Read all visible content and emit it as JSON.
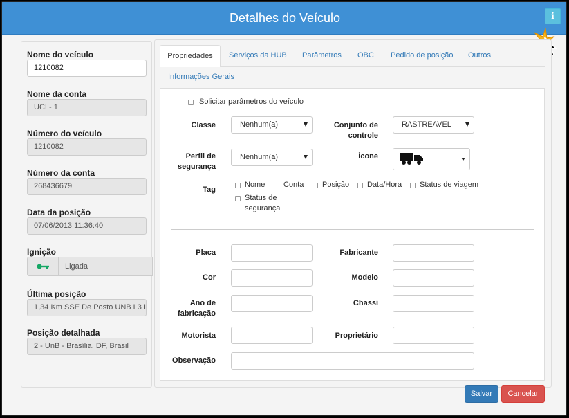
{
  "window": {
    "title": "Detalhes do Veículo",
    "info_icon": "i"
  },
  "left": {
    "vehicle_name": {
      "label": "Nome do veículo",
      "value": "1210082"
    },
    "account_name": {
      "label": "Nome da conta",
      "value": "UCI - 1"
    },
    "vehicle_number": {
      "label": "Número do veículo",
      "value": "1210082"
    },
    "account_number": {
      "label": "Número da conta",
      "value": "268436679"
    },
    "position_date": {
      "label": "Data da posição",
      "value": "07/06/2013 11:36:40"
    },
    "ignition": {
      "label": "Ignição",
      "value": "Ligada",
      "icon": "key-icon"
    },
    "last_position": {
      "label": "Última posição",
      "value": "1,34 Km SSE De Posto UNB L3 I"
    },
    "detailed_position": {
      "label": "Posição detalhada",
      "value": "2 - UnB - Brasília, DF, Brasil"
    }
  },
  "tabs": [
    "Propriedades",
    "Serviços da HUB",
    "Parâmetros",
    "OBC",
    "Pedido de posição",
    "Outros",
    "Informações Gerais"
  ],
  "props": {
    "request_params": "Solicitar parâmetros do veículo",
    "class_label": "Classe",
    "class_value": "Nenhum(a)",
    "control_set_label_1": "Conjunto de",
    "control_set_label_2": "controle",
    "control_set_value": "RASTREAVEL",
    "security_label_1": "Perfil de",
    "security_label_2": "segurança",
    "security_value": "Nenhum(a)",
    "icon_label": "Ícone",
    "tag_label": "Tag",
    "tags": [
      "Nome",
      "Conta",
      "Posição",
      "Data/Hora",
      "Status de viagem"
    ],
    "tag_security_1": "Status de",
    "tag_security_2": "segurança",
    "plate_label": "Placa",
    "maker_label": "Fabricante",
    "color_label": "Cor",
    "model_label": "Modelo",
    "year_label_1": "Ano de",
    "year_label_2": "fabricação",
    "chassis_label": "Chassi",
    "driver_label": "Motorista",
    "owner_label": "Proprietário",
    "notes_label": "Observação"
  },
  "buttons": {
    "save": "Salvar",
    "cancel": "Cancelar"
  },
  "colors": {
    "titlebar": "#3f90d5",
    "save": "#337ab7",
    "cancel": "#d9534f",
    "key": "#16a765"
  }
}
